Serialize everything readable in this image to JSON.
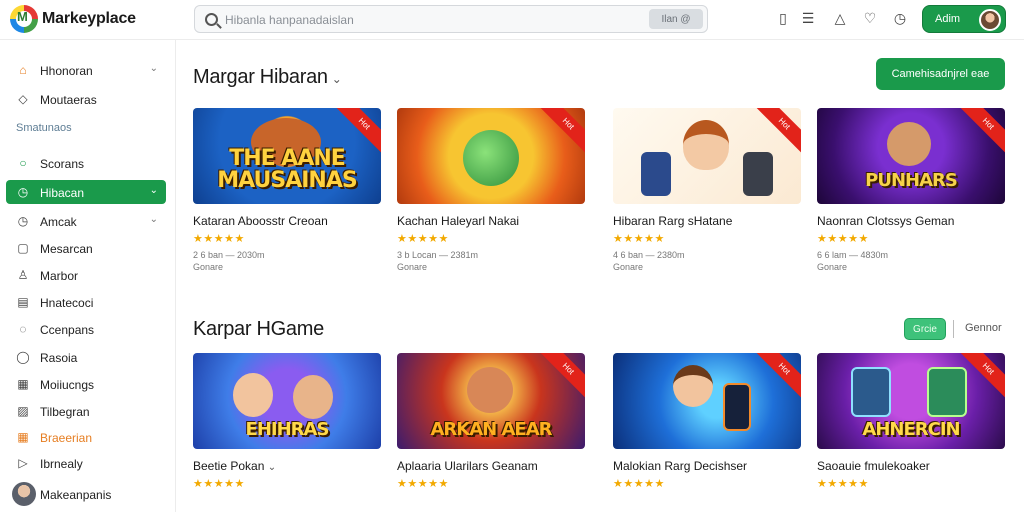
{
  "app": {
    "brand": "Markeyplace"
  },
  "search": {
    "placeholder": "Hibanla hanpanadaislan",
    "button": "Ilan @"
  },
  "header": {
    "user_button": "Adim"
  },
  "sidebar": {
    "items": [
      {
        "label": "Hhonoran",
        "icon": "home-icon",
        "chevron": true
      },
      {
        "label": "Moutaeras",
        "icon": "shield-icon",
        "chevron": false
      },
      {
        "label": "Scorans",
        "icon": "circle-icon",
        "chevron": false
      },
      {
        "label": "Hibacan",
        "icon": "clock-icon",
        "chevron": true,
        "active": true
      },
      {
        "label": "Amcak",
        "icon": "clock-icon",
        "chevron": true
      },
      {
        "label": "Mesarcan",
        "icon": "square-icon",
        "chevron": false
      },
      {
        "label": "Marbor",
        "icon": "users-icon",
        "chevron": false
      },
      {
        "label": "Hnatecoci",
        "icon": "document-icon",
        "chevron": false
      },
      {
        "label": "Ccenpans",
        "icon": "chat-icon",
        "chevron": false
      },
      {
        "label": "Rasoia",
        "icon": "chat-icon",
        "chevron": false
      },
      {
        "label": "Moiiucngs",
        "icon": "calendar-icon",
        "chevron": false
      },
      {
        "label": "Tilbegran",
        "icon": "image-icon",
        "chevron": false
      },
      {
        "label": "Braeerian",
        "icon": "grid-icon",
        "chevron": false,
        "highlight": true
      },
      {
        "label": "Ibrnealy",
        "icon": "play-icon",
        "chevron": false
      }
    ],
    "section_label": "Smatunaos",
    "user_name": "Makeanpanis"
  },
  "main": {
    "section1": {
      "title": "Margar Hibaran",
      "action_button": "Camehisadnjrel eae"
    },
    "section2": {
      "title": "Karpar HGame",
      "toggle_button": "Grcie",
      "filter_link": "Gennor"
    },
    "row1": [
      {
        "title": "Kataran Aboosstr Creoan",
        "caption": "THE AANE MAUSAINAS",
        "badge": "Hot",
        "rating": "★★★★★",
        "meta": "2 6 ban — 2030m",
        "meta2": "Gonare"
      },
      {
        "title": "Kachan Haleyarl Nakai",
        "caption": "",
        "badge": "Hot",
        "rating": "★★★★★",
        "meta": "3 b Locan — 2381m",
        "meta2": "Gonare"
      },
      {
        "title": "Hibaran Rarg sHatane",
        "caption": "",
        "badge": "Hot",
        "rating": "★★★★★",
        "meta": "4 6 ban — 2380m",
        "meta2": "Gonare"
      },
      {
        "title": "Naonran Clotssys Geman",
        "caption": "PUNHARS",
        "badge": "Hot",
        "rating": "★★★★★",
        "meta": "6 6 lam — 4830m",
        "meta2": "Gonare"
      }
    ],
    "row2": [
      {
        "title": "Beetie Pokan",
        "caption": "EHIHRAS",
        "badge": "",
        "rating": "★★★★★"
      },
      {
        "title": "Aplaaria Ularilars Geanam",
        "caption": "ARKAN AEAR",
        "badge": "Hot",
        "rating": "★★★★★"
      },
      {
        "title": "Malokian Rarg Decishser",
        "caption": "",
        "badge": "Hot",
        "rating": "★★★★★"
      },
      {
        "title": "Saoauie fmulekoaker",
        "caption": "AHNERCIN",
        "badge": "Hot",
        "rating": "★★★★★"
      }
    ]
  },
  "colors": {
    "accent": "#1a9a4b",
    "badge": "#e2231a",
    "star": "#f2a900"
  }
}
